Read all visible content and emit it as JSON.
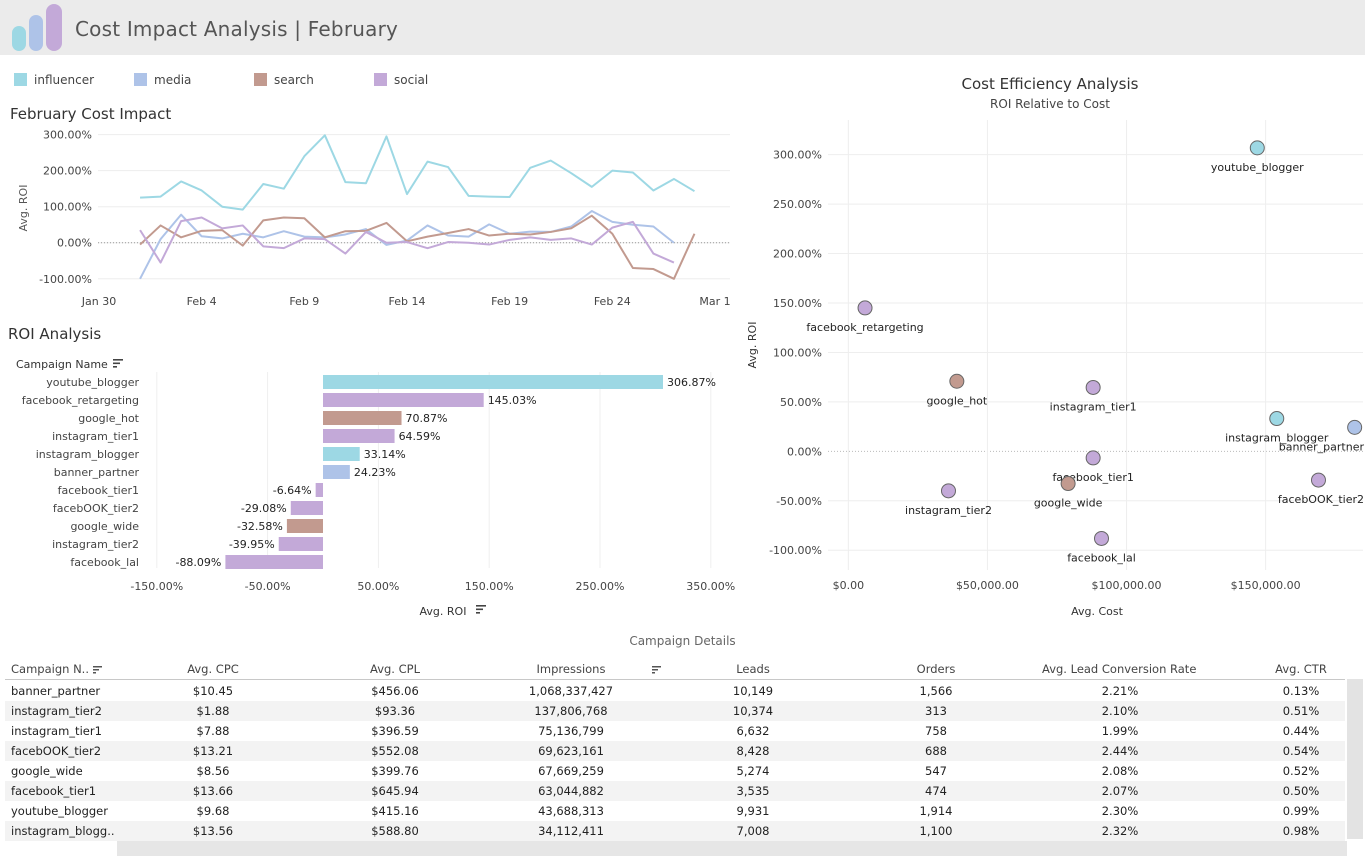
{
  "header": {
    "title": "Cost Impact Analysis | February"
  },
  "colors": {
    "influencer": "#9dd8e4",
    "media": "#aec3e8",
    "search": "#c29a8f",
    "social": "#c3a9d8"
  },
  "legend": [
    {
      "label": "influencer",
      "color": "#9dd8e4"
    },
    {
      "label": "media",
      "color": "#aec3e8"
    },
    {
      "label": "search",
      "color": "#c29a8f"
    },
    {
      "label": "social",
      "color": "#c3a9d8"
    }
  ],
  "line_chart_title": "February Cost Impact",
  "bar_chart_title": "ROI Analysis",
  "scatter_title": "Cost Efficiency Analysis",
  "scatter_subtitle": "ROI Relative to Cost",
  "chart_data": [
    {
      "type": "line",
      "title": "February Cost Impact",
      "ylabel": "Avg. ROI",
      "ylim": [
        -120,
        310
      ],
      "yticks": [
        "300.00%",
        "200.00%",
        "100.00%",
        "0.00%",
        "-100.00%"
      ],
      "ytick_values": [
        300,
        200,
        100,
        0,
        -100
      ],
      "xtick_labels": [
        "Jan 30",
        "Feb 4",
        "Feb 9",
        "Feb 14",
        "Feb 19",
        "Feb 24",
        "Mar 1"
      ],
      "xtick_values": [
        0,
        5,
        10,
        15,
        20,
        25,
        30
      ],
      "x": [
        2,
        3,
        4,
        5,
        6,
        7,
        8,
        9,
        10,
        11,
        12,
        13,
        14,
        15,
        16,
        17,
        18,
        19,
        20,
        21,
        22,
        23,
        24,
        25,
        26,
        27,
        28,
        29
      ],
      "series": [
        {
          "name": "influencer",
          "values": [
            125,
            128,
            170,
            145,
            100,
            92,
            163,
            150,
            240,
            298,
            168,
            165,
            295,
            135,
            225,
            210,
            130,
            128,
            127,
            208,
            228,
            193,
            155,
            200,
            195,
            145,
            177,
            143
          ]
        },
        {
          "name": "media",
          "values": [
            -100,
            10,
            78,
            18,
            12,
            25,
            15,
            32,
            17,
            15,
            23,
            38,
            -6,
            6,
            48,
            20,
            17,
            51,
            25,
            31,
            30,
            45,
            88,
            58,
            50,
            45,
            0
          ]
        },
        {
          "name": "search",
          "values": [
            -5,
            48,
            15,
            33,
            35,
            -8,
            62,
            70,
            68,
            15,
            32,
            33,
            55,
            4,
            17,
            27,
            38,
            20,
            25,
            23,
            30,
            40,
            75,
            25,
            -70,
            -73,
            -100,
            25
          ]
        },
        {
          "name": "social",
          "values": [
            35,
            -55,
            60,
            70,
            40,
            48,
            -10,
            -15,
            12,
            10,
            -30,
            30,
            0,
            2,
            -15,
            2,
            0,
            -5,
            8,
            15,
            8,
            12,
            -5,
            42,
            58,
            -30,
            -55
          ]
        }
      ]
    },
    {
      "type": "bar",
      "title": "ROI Analysis",
      "ylabel": "Campaign Name",
      "xlabel": "Avg. ROI",
      "xlim": [
        -175,
        375
      ],
      "xtick_labels": [
        "-150.00%",
        "-50.00%",
        "50.00%",
        "150.00%",
        "250.00%",
        "350.00%"
      ],
      "xtick_values": [
        -150,
        -50,
        50,
        150,
        250,
        350
      ],
      "categories": [
        "youtube_blogger",
        "facebook_retargeting",
        "google_hot",
        "instagram_tier1",
        "instagram_blogger",
        "banner_partner",
        "facebook_tier1",
        "facebOOK_tier2",
        "google_wide",
        "instagram_tier2",
        "facebook_lal"
      ],
      "values": [
        306.87,
        145.03,
        70.87,
        64.59,
        33.14,
        24.23,
        -6.64,
        -29.08,
        -32.58,
        -39.95,
        -88.09
      ],
      "labels": [
        "306.87%",
        "145.03%",
        "70.87%",
        "64.59%",
        "33.14%",
        "24.23%",
        "-6.64%",
        "-29.08%",
        "-32.58%",
        "-39.95%",
        "-88.09%"
      ],
      "groups": [
        "influencer",
        "social",
        "search",
        "social",
        "influencer",
        "media",
        "social",
        "social",
        "search",
        "social",
        "social"
      ]
    },
    {
      "type": "scatter",
      "title": "Cost Efficiency Analysis",
      "subtitle": "ROI Relative to Cost",
      "xlabel": "Avg. Cost",
      "ylabel": "Avg. ROI",
      "xlim": [
        -3000,
        185000
      ],
      "ylim": [
        -120,
        330
      ],
      "xtick_labels": [
        "$0.00",
        "$50,000.00",
        "$100,000.00",
        "$150,000.00"
      ],
      "xtick_values": [
        0,
        50000,
        100000,
        150000
      ],
      "ytick_labels": [
        "300.00%",
        "250.00%",
        "200.00%",
        "150.00%",
        "100.00%",
        "50.00%",
        "0.00%",
        "-50.00%",
        "-100.00%"
      ],
      "ytick_values": [
        300,
        250,
        200,
        150,
        100,
        50,
        0,
        -50,
        -100
      ],
      "points": [
        {
          "label": "youtube_blogger",
          "x": 147000,
          "y": 306.87,
          "group": "influencer",
          "anchor": "below"
        },
        {
          "label": "facebook_retargeting",
          "x": 6000,
          "y": 145.03,
          "group": "social",
          "anchor": "below"
        },
        {
          "label": "google_hot",
          "x": 39000,
          "y": 70.87,
          "group": "search",
          "anchor": "below"
        },
        {
          "label": "instagram_tier1",
          "x": 88000,
          "y": 64.59,
          "group": "social",
          "anchor": "below"
        },
        {
          "label": "instagram_blogger",
          "x": 154000,
          "y": 33.14,
          "group": "influencer",
          "anchor": "below"
        },
        {
          "label": "banner_partner",
          "x": 182000,
          "y": 24.23,
          "group": "media",
          "anchor": "below"
        },
        {
          "label": "facebook_tier1",
          "x": 88000,
          "y": -6.64,
          "group": "social",
          "anchor": "below"
        },
        {
          "label": "facebOOK_tier2",
          "x": 169000,
          "y": -29.08,
          "group": "social",
          "anchor": "below"
        },
        {
          "label": "google_wide",
          "x": 79000,
          "y": -32.58,
          "group": "search",
          "anchor": "below"
        },
        {
          "label": "instagram_tier2",
          "x": 36000,
          "y": -39.95,
          "group": "social",
          "anchor": "below"
        },
        {
          "label": "facebook_lal",
          "x": 91000,
          "y": -88.09,
          "group": "social",
          "anchor": "below"
        }
      ]
    }
  ],
  "table": {
    "title": "Campaign Details",
    "headers": [
      "Campaign N..",
      "Avg. CPC",
      "Avg. CPL",
      "Impressions",
      "Leads",
      "Orders",
      "Avg. Lead Conversion Rate",
      "Avg. CTR"
    ],
    "rows": [
      [
        "banner_partner",
        "$10.45",
        "$456.06",
        "1,068,337,427",
        "10,149",
        "1,566",
        "2.21%",
        "0.13%"
      ],
      [
        "instagram_tier2",
        "$1.88",
        "$93.36",
        "137,806,768",
        "10,374",
        "313",
        "2.10%",
        "0.51%"
      ],
      [
        "instagram_tier1",
        "$7.88",
        "$396.59",
        "75,136,799",
        "6,632",
        "758",
        "1.99%",
        "0.44%"
      ],
      [
        "facebOOK_tier2",
        "$13.21",
        "$552.08",
        "69,623,161",
        "8,428",
        "688",
        "2.44%",
        "0.54%"
      ],
      [
        "google_wide",
        "$8.56",
        "$399.76",
        "67,669,259",
        "5,274",
        "547",
        "2.08%",
        "0.52%"
      ],
      [
        "facebook_tier1",
        "$13.66",
        "$645.94",
        "63,044,882",
        "3,535",
        "474",
        "2.07%",
        "0.50%"
      ],
      [
        "youtube_blogger",
        "$9.68",
        "$415.16",
        "43,688,313",
        "9,931",
        "1,914",
        "2.30%",
        "0.99%"
      ],
      [
        "instagram_blogg..",
        "$13.56",
        "$588.80",
        "34,112,411",
        "7,008",
        "1,100",
        "2.32%",
        "0.98%"
      ]
    ]
  }
}
